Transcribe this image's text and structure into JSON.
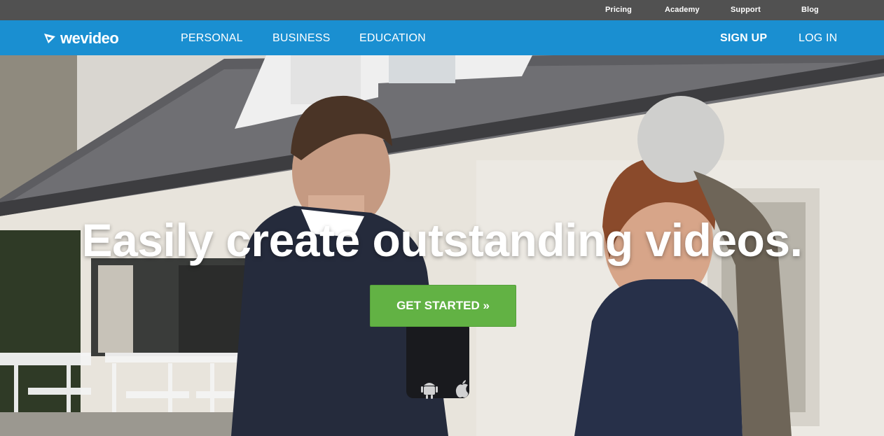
{
  "topbar": {
    "links": [
      "Pricing",
      "Academy",
      "Support",
      "Blog"
    ]
  },
  "navbar": {
    "logo_text": "wevideo",
    "items": [
      "PERSONAL",
      "BUSINESS",
      "EDUCATION"
    ],
    "sign_up": "SIGN UP",
    "log_in": "LOG IN"
  },
  "hero": {
    "headline": "Easily create outstanding videos.",
    "cta_label": "GET STARTED »",
    "platform_icons": [
      "android-icon",
      "apple-icon"
    ]
  },
  "colors": {
    "topbar_bg": "#515151",
    "navbar_bg": "#1a8fd1",
    "cta_bg": "#62b244"
  }
}
